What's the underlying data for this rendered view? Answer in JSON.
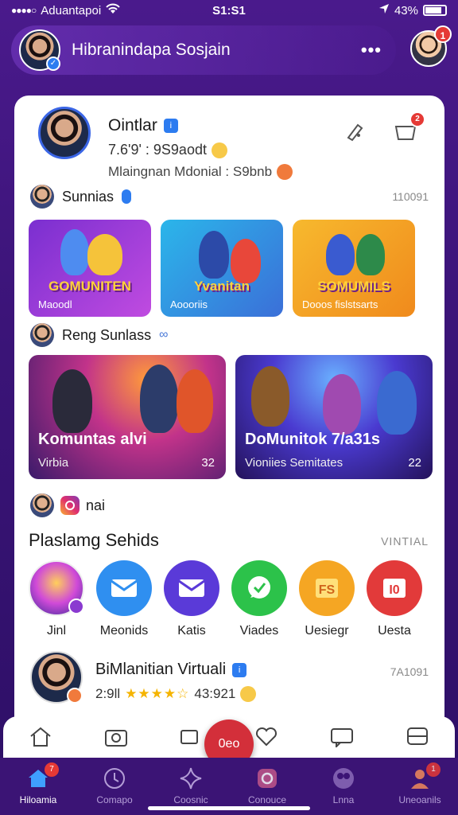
{
  "status": {
    "carrier": "Aduantapoi",
    "time": "S1:S1",
    "battery": "43%"
  },
  "header": {
    "title": "Hibranindapa Sosjain",
    "more": "•••",
    "notif_count": "1"
  },
  "profile": {
    "name": "Ointlar",
    "stats": "7.6'9' : 9S9aodt",
    "subtitle": "Mlaingnan Mdonial : S9bnb"
  },
  "section1": {
    "title": "Sunnias",
    "meta": "110091"
  },
  "tiles": [
    {
      "title": "GOMUNITEN",
      "caption": "Maoodl"
    },
    {
      "title": "Yvanitan",
      "caption": "Aoooriis"
    },
    {
      "title": "SOMUMILS",
      "caption": "Dooos fislstsarts"
    }
  ],
  "section2": {
    "title": "Reng Sunlass"
  },
  "big_tiles": [
    {
      "title": "Komuntas alvi",
      "sub": "Virbia",
      "count": "32"
    },
    {
      "title": "DoMunitok 7/a31s",
      "sub": "Vioniies Semitates",
      "count": "22"
    }
  ],
  "ig_row": {
    "text": "nai"
  },
  "apps_section": {
    "title": "Plaslamg Sehids",
    "meta": "VINTIAL"
  },
  "apps": [
    {
      "label": "Jinl"
    },
    {
      "label": "Meonids"
    },
    {
      "label": "Katis"
    },
    {
      "label": "Viades"
    },
    {
      "label": "Uesiegr"
    },
    {
      "label": "Uesta"
    }
  ],
  "bottom_profile": {
    "name": "BiMlanitian Virtuali",
    "stats_left": "2:9ll",
    "stats_right": "43:921",
    "meta": "7A1091"
  },
  "fab": {
    "label": "0eo"
  },
  "nav": [
    {
      "label": "Hiloamia",
      "badge": "7"
    },
    {
      "label": "Comapo"
    },
    {
      "label": "Coosnic"
    },
    {
      "label": "Conouce"
    },
    {
      "label": "Lnna"
    },
    {
      "label": "Uneoanils",
      "badge": "1"
    }
  ],
  "colors": {
    "brand_purple": "#4a1a8c",
    "accent_red": "#d32f3a",
    "verify_blue": "#2d7cf0"
  }
}
